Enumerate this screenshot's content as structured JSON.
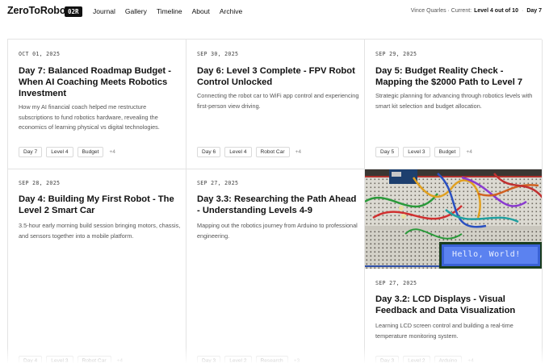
{
  "header": {
    "logo": "ZeroToRobot",
    "badge": "02R",
    "nav": [
      "Journal",
      "Gallery",
      "Timeline",
      "About",
      "Archive"
    ],
    "user": "Vince Quarles · Current:",
    "level": "Level 4 out of 10",
    "separator": "·",
    "day": "Day 7"
  },
  "cards": [
    {
      "date": "OCT 01, 2025",
      "title": "Day 7: Balanced Roadmap Budget - When AI Coaching Meets Robotics Investment",
      "description": "How my AI financial coach helped me restructure subscriptions to fund robotics hardware, revealing the economics of learning physical vs digital technologies.",
      "tags": [
        "Day 7",
        "Level 4",
        "Budget"
      ],
      "more": "+4"
    },
    {
      "date": "SEP 30, 2025",
      "title": "Day 6: Level 3 Complete - FPV Robot Control Unlocked",
      "description": "Connecting the robot car to WiFi app control and experiencing first-person view driving.",
      "tags": [
        "Day 6",
        "Level 4",
        "Robot Car"
      ],
      "more": "+4"
    },
    {
      "date": "SEP 29, 2025",
      "title": "Day 5: Budget Reality Check - Mapping the $2000 Path to Level 7",
      "description": "Strategic planning for advancing through robotics levels with smart kit selection and budget allocation.",
      "tags": [
        "Day 5",
        "Level 3",
        "Budget"
      ],
      "more": "+4"
    },
    {
      "date": "SEP 28, 2025",
      "title": "Day 4: Building My First Robot - The Level 2 Smart Car",
      "description": "3.5-hour early morning build session bringing motors, chassis, and sensors together into a mobile platform.",
      "tags": [
        "Day 4",
        "Level 3",
        "Robot Car"
      ],
      "more": "+4"
    },
    {
      "date": "SEP 27, 2025",
      "title": "Day 3.3: Researching the Path Ahead - Understanding Levels 4-9",
      "description": "Mapping out the robotics journey from Arduino to professional engineering.",
      "tags": [
        "Day 3",
        "Level 2",
        "Research"
      ],
      "more": "+3"
    },
    {
      "date": "SEP 27, 2025",
      "title": "Day 3.2: LCD Displays - Visual Feedback and Data Visualization",
      "description": "Learning LCD screen control and building a real-time temperature monitoring system.",
      "tags": [
        "Day 3",
        "Level 2",
        "Arduino"
      ],
      "more": "+4",
      "image_text": "Hello, World!"
    }
  ]
}
